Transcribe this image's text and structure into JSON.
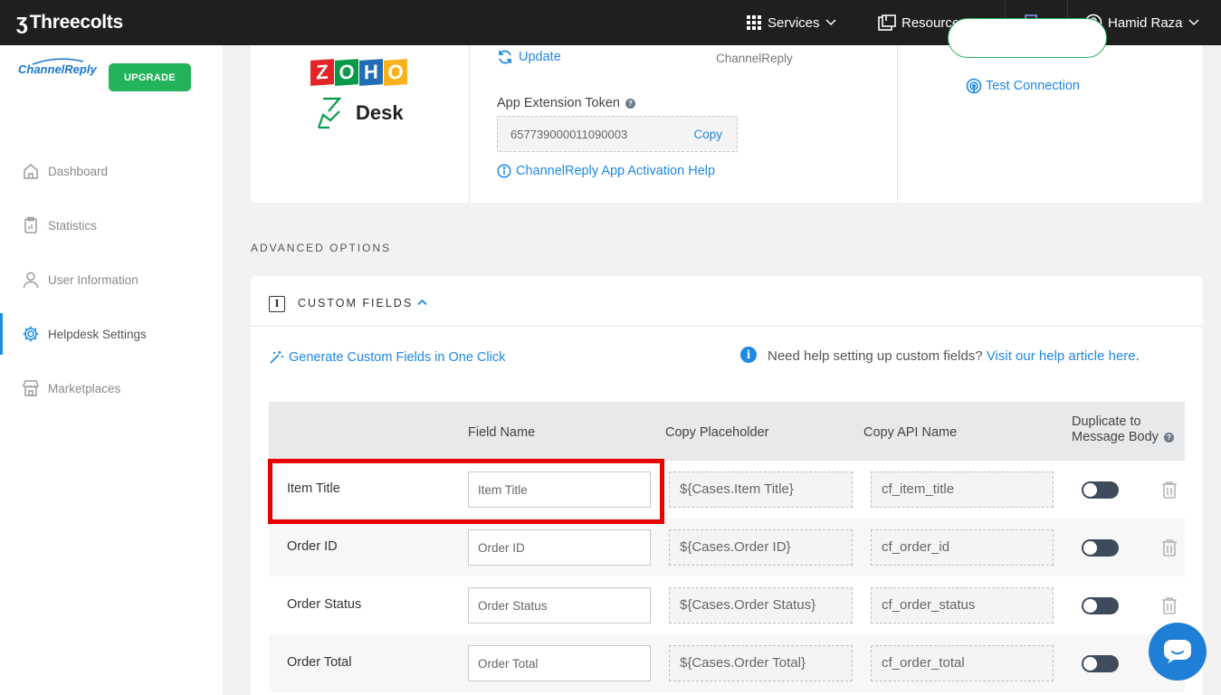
{
  "topbar": {
    "brand": "Threecolts",
    "services_label": "Services",
    "resources_label": "Resources",
    "user_name": "Hamid Raza"
  },
  "sidebar": {
    "logo_text": "ChannelReply",
    "upgrade_label": "UPGRADE",
    "items": [
      {
        "label": "Dashboard",
        "icon": "home-icon"
      },
      {
        "label": "Statistics",
        "icon": "clipboard-icon"
      },
      {
        "label": "User Information",
        "icon": "user-icon"
      },
      {
        "label": "Helpdesk Settings",
        "icon": "gear-icon",
        "active": true
      },
      {
        "label": "Marketplaces",
        "icon": "store-icon"
      }
    ]
  },
  "integration": {
    "logo_top": "ZOHO",
    "logo_bottom": "Desk",
    "update_label": "Update",
    "channelreply_value": "ChannelReply",
    "token_label": "App Extension Token",
    "token_value": "657739000011090003",
    "copy_label": "Copy",
    "help_link": "ChannelReply App Activation Help",
    "test_connection_label": "Test Connection"
  },
  "advanced": {
    "title": "ADVANCED OPTIONS"
  },
  "custom_fields": {
    "title": "CUSTOM FIELDS",
    "generate_label": "Generate Custom Fields in One Click",
    "help_prefix": "Need help setting up custom fields?",
    "help_link": "Visit our help article here",
    "help_suffix": ".",
    "columns": {
      "field_name": "Field Name",
      "copy_placeholder": "Copy Placeholder",
      "copy_api": "Copy API Name",
      "duplicate_line1": "Duplicate to",
      "duplicate_line2": "Message Body"
    },
    "rows": [
      {
        "name": "Item Title",
        "field": "Item Title",
        "placeholder": "${Cases.Item Title}",
        "api": "cf_item_title"
      },
      {
        "name": "Order ID",
        "field": "Order ID",
        "placeholder": "${Cases.Order ID}",
        "api": "cf_order_id"
      },
      {
        "name": "Order Status",
        "field": "Order Status",
        "placeholder": "${Cases.Order Status}",
        "api": "cf_order_status"
      },
      {
        "name": "Order Total",
        "field": "Order Total",
        "placeholder": "${Cases.Order Total}",
        "api": "cf_order_total"
      }
    ]
  },
  "colors": {
    "accent": "#1e88e5",
    "upgrade": "#23b35a",
    "highlight": "#e60000",
    "topbar": "#1f1f1f"
  }
}
